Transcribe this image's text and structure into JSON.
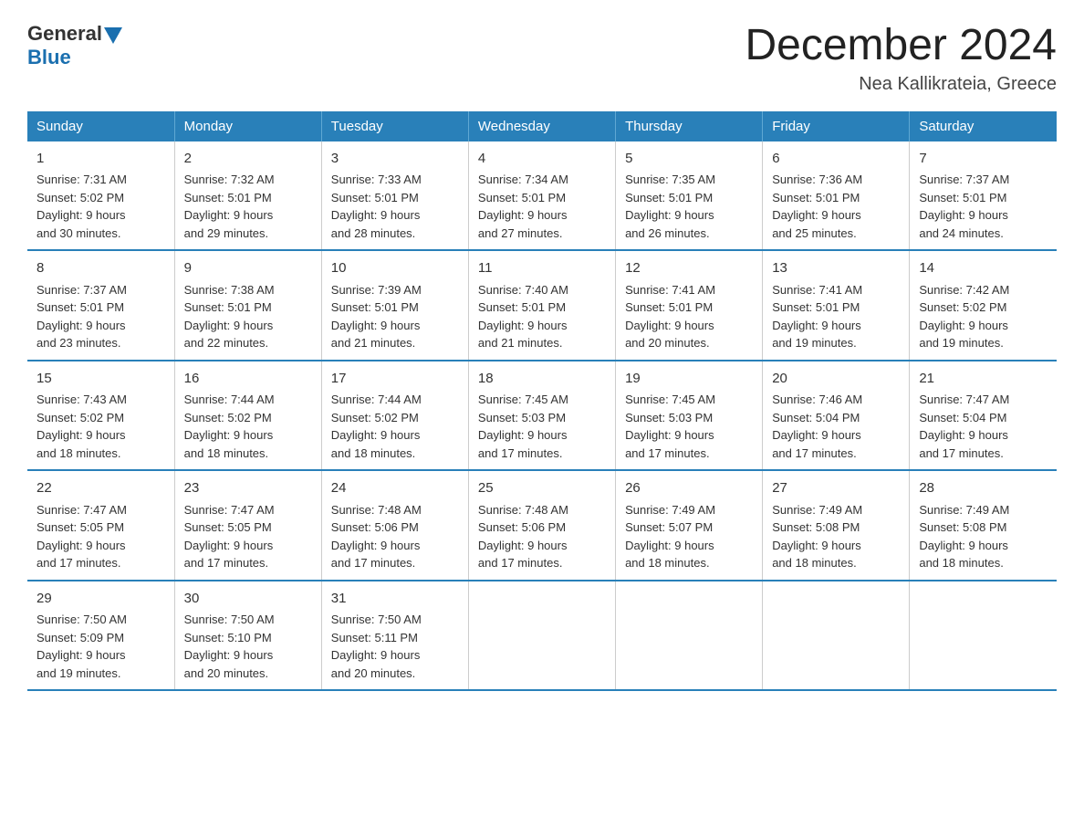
{
  "logo": {
    "general": "General",
    "blue": "Blue"
  },
  "header": {
    "title": "December 2024",
    "location": "Nea Kallikrateia, Greece"
  },
  "days_of_week": [
    "Sunday",
    "Monday",
    "Tuesday",
    "Wednesday",
    "Thursday",
    "Friday",
    "Saturday"
  ],
  "weeks": [
    [
      {
        "day": "1",
        "sunrise": "7:31 AM",
        "sunset": "5:02 PM",
        "daylight": "9 hours and 30 minutes."
      },
      {
        "day": "2",
        "sunrise": "7:32 AM",
        "sunset": "5:01 PM",
        "daylight": "9 hours and 29 minutes."
      },
      {
        "day": "3",
        "sunrise": "7:33 AM",
        "sunset": "5:01 PM",
        "daylight": "9 hours and 28 minutes."
      },
      {
        "day": "4",
        "sunrise": "7:34 AM",
        "sunset": "5:01 PM",
        "daylight": "9 hours and 27 minutes."
      },
      {
        "day": "5",
        "sunrise": "7:35 AM",
        "sunset": "5:01 PM",
        "daylight": "9 hours and 26 minutes."
      },
      {
        "day": "6",
        "sunrise": "7:36 AM",
        "sunset": "5:01 PM",
        "daylight": "9 hours and 25 minutes."
      },
      {
        "day": "7",
        "sunrise": "7:37 AM",
        "sunset": "5:01 PM",
        "daylight": "9 hours and 24 minutes."
      }
    ],
    [
      {
        "day": "8",
        "sunrise": "7:37 AM",
        "sunset": "5:01 PM",
        "daylight": "9 hours and 23 minutes."
      },
      {
        "day": "9",
        "sunrise": "7:38 AM",
        "sunset": "5:01 PM",
        "daylight": "9 hours and 22 minutes."
      },
      {
        "day": "10",
        "sunrise": "7:39 AM",
        "sunset": "5:01 PM",
        "daylight": "9 hours and 21 minutes."
      },
      {
        "day": "11",
        "sunrise": "7:40 AM",
        "sunset": "5:01 PM",
        "daylight": "9 hours and 21 minutes."
      },
      {
        "day": "12",
        "sunrise": "7:41 AM",
        "sunset": "5:01 PM",
        "daylight": "9 hours and 20 minutes."
      },
      {
        "day": "13",
        "sunrise": "7:41 AM",
        "sunset": "5:01 PM",
        "daylight": "9 hours and 19 minutes."
      },
      {
        "day": "14",
        "sunrise": "7:42 AM",
        "sunset": "5:02 PM",
        "daylight": "9 hours and 19 minutes."
      }
    ],
    [
      {
        "day": "15",
        "sunrise": "7:43 AM",
        "sunset": "5:02 PM",
        "daylight": "9 hours and 18 minutes."
      },
      {
        "day": "16",
        "sunrise": "7:44 AM",
        "sunset": "5:02 PM",
        "daylight": "9 hours and 18 minutes."
      },
      {
        "day": "17",
        "sunrise": "7:44 AM",
        "sunset": "5:02 PM",
        "daylight": "9 hours and 18 minutes."
      },
      {
        "day": "18",
        "sunrise": "7:45 AM",
        "sunset": "5:03 PM",
        "daylight": "9 hours and 17 minutes."
      },
      {
        "day": "19",
        "sunrise": "7:45 AM",
        "sunset": "5:03 PM",
        "daylight": "9 hours and 17 minutes."
      },
      {
        "day": "20",
        "sunrise": "7:46 AM",
        "sunset": "5:04 PM",
        "daylight": "9 hours and 17 minutes."
      },
      {
        "day": "21",
        "sunrise": "7:47 AM",
        "sunset": "5:04 PM",
        "daylight": "9 hours and 17 minutes."
      }
    ],
    [
      {
        "day": "22",
        "sunrise": "7:47 AM",
        "sunset": "5:05 PM",
        "daylight": "9 hours and 17 minutes."
      },
      {
        "day": "23",
        "sunrise": "7:47 AM",
        "sunset": "5:05 PM",
        "daylight": "9 hours and 17 minutes."
      },
      {
        "day": "24",
        "sunrise": "7:48 AM",
        "sunset": "5:06 PM",
        "daylight": "9 hours and 17 minutes."
      },
      {
        "day": "25",
        "sunrise": "7:48 AM",
        "sunset": "5:06 PM",
        "daylight": "9 hours and 17 minutes."
      },
      {
        "day": "26",
        "sunrise": "7:49 AM",
        "sunset": "5:07 PM",
        "daylight": "9 hours and 18 minutes."
      },
      {
        "day": "27",
        "sunrise": "7:49 AM",
        "sunset": "5:08 PM",
        "daylight": "9 hours and 18 minutes."
      },
      {
        "day": "28",
        "sunrise": "7:49 AM",
        "sunset": "5:08 PM",
        "daylight": "9 hours and 18 minutes."
      }
    ],
    [
      {
        "day": "29",
        "sunrise": "7:50 AM",
        "sunset": "5:09 PM",
        "daylight": "9 hours and 19 minutes."
      },
      {
        "day": "30",
        "sunrise": "7:50 AM",
        "sunset": "5:10 PM",
        "daylight": "9 hours and 20 minutes."
      },
      {
        "day": "31",
        "sunrise": "7:50 AM",
        "sunset": "5:11 PM",
        "daylight": "9 hours and 20 minutes."
      },
      null,
      null,
      null,
      null
    ]
  ],
  "labels": {
    "sunrise": "Sunrise:",
    "sunset": "Sunset:",
    "daylight": "Daylight:"
  }
}
